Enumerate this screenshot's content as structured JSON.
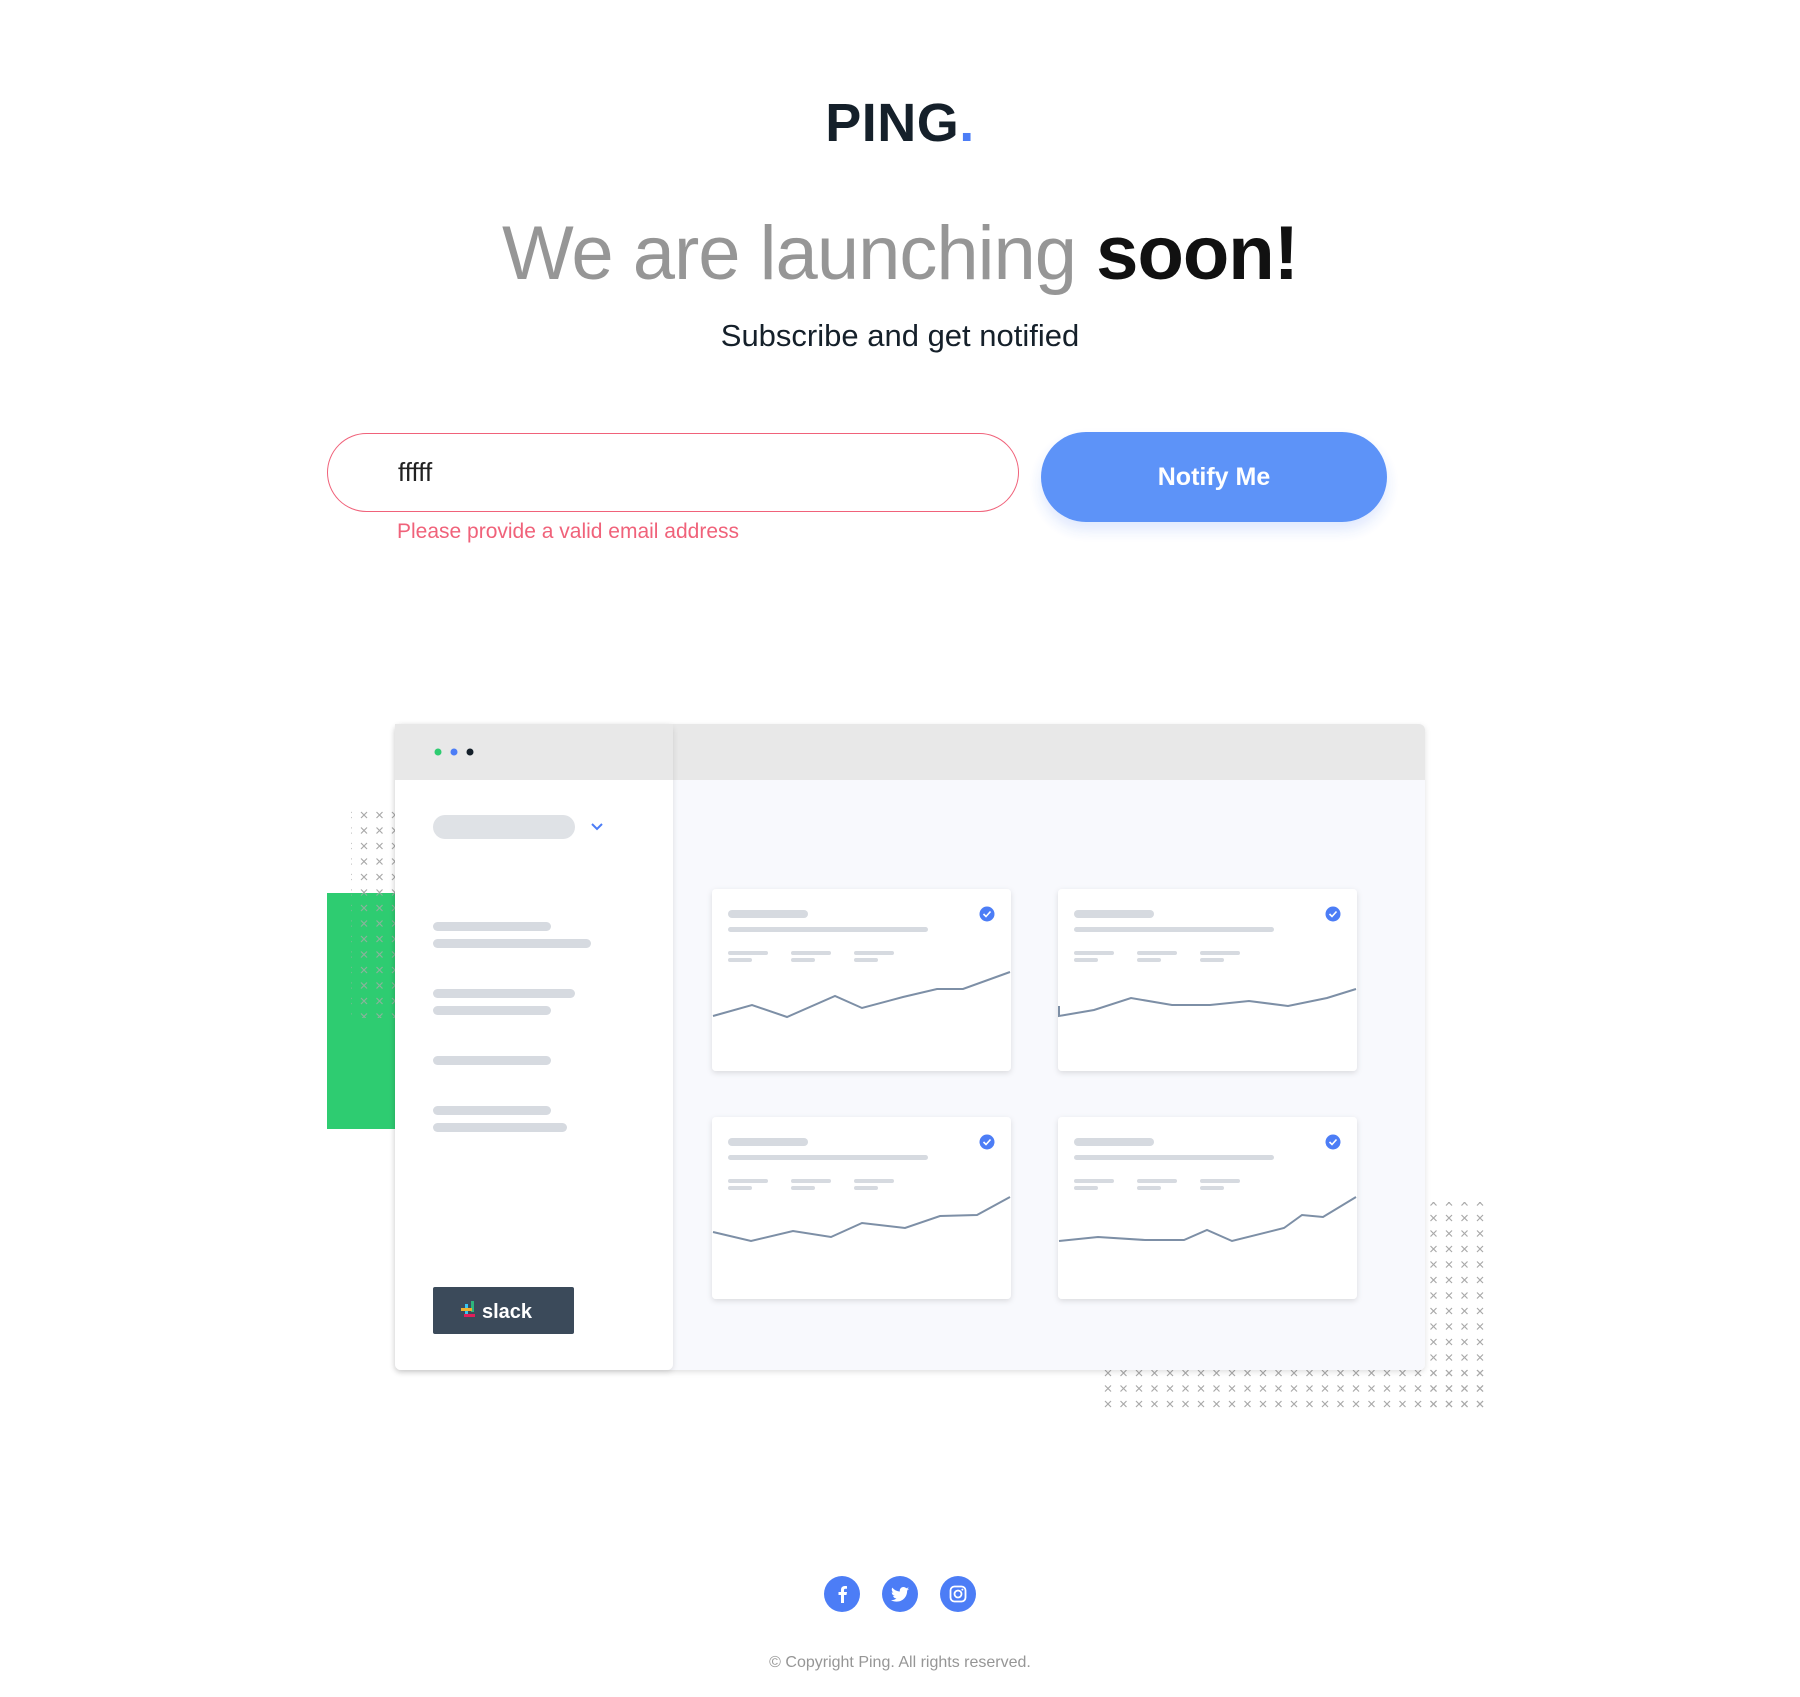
{
  "brand": {
    "name": "PING",
    "dot": ".",
    "accent_color": "#4c7df6"
  },
  "hero": {
    "headline_light": "We are launching",
    "headline_bold": "soon!",
    "subhead": "Subscribe and get notified"
  },
  "form": {
    "email_value": "fffff",
    "error_message": "Please provide a valid email address",
    "error_color": "#f0627a",
    "submit_label": "Notify Me"
  },
  "illustration": {
    "window_dot_colors": [
      "#2ecc71",
      "#4c7df6",
      "#15202a"
    ],
    "side_accent_color": "#2ecc71",
    "slack_label": "slack",
    "card_count": 4
  },
  "footer": {
    "socials": [
      {
        "name": "facebook",
        "icon": "facebook-icon"
      },
      {
        "name": "twitter",
        "icon": "twitter-icon"
      },
      {
        "name": "instagram",
        "icon": "instagram-icon"
      }
    ],
    "copyright": "© Copyright Ping. All rights reserved."
  }
}
